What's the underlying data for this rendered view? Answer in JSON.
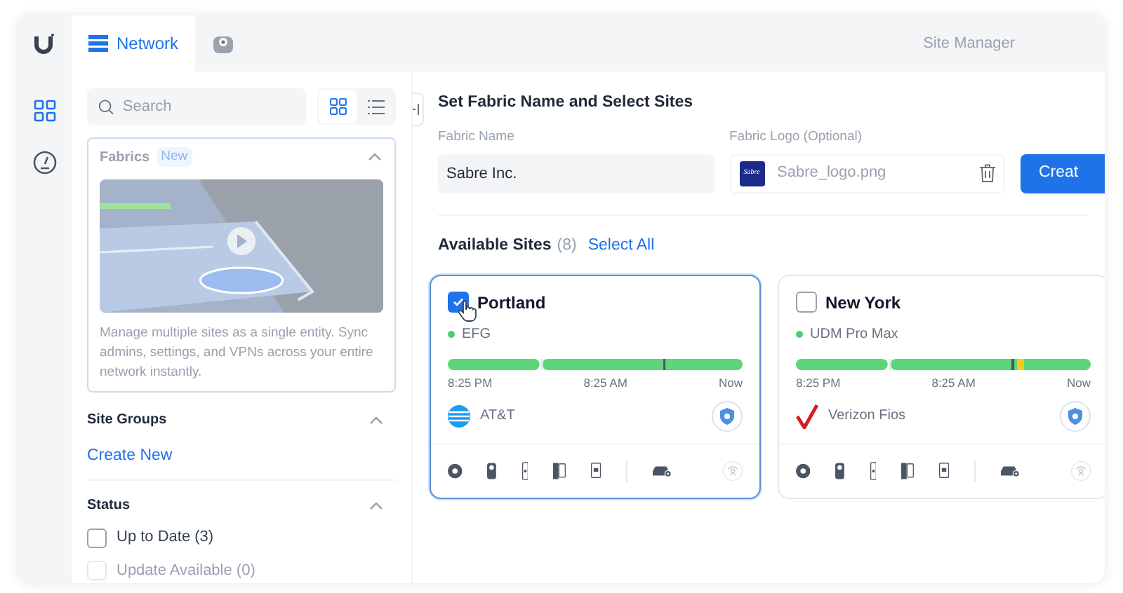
{
  "topbar": {
    "tabs": [
      {
        "label": "Network",
        "selected": true,
        "kind": "network"
      },
      {
        "selected": false,
        "kind": "protect"
      }
    ],
    "title": "Site Manager"
  },
  "sidebar": {
    "search": {
      "placeholder": "Search"
    },
    "view_toggle": [
      {
        "kind": "grid",
        "selected": true
      },
      {
        "kind": "list",
        "selected": false
      }
    ],
    "fabrics": {
      "title": "Fabrics",
      "badge": "New",
      "expanded": true,
      "description": "Manage multiple sites as a single entity. Sync admins, settings, and VPNs across your entire network instantly."
    },
    "site_groups": {
      "title": "Site Groups",
      "expanded": true,
      "link": "Create New"
    },
    "status": {
      "title": "Status",
      "expanded": true,
      "options": [
        {
          "label": "Up to Date (3)",
          "checked": false,
          "disabled": false
        },
        {
          "label": "Update Available (0)",
          "checked": false,
          "disabled": true
        }
      ]
    }
  },
  "form": {
    "heading": "Set Fabric Name and Select Sites",
    "name_label": "Fabric Name",
    "name_value": "Sabre Inc.",
    "logo_label": "Fabric Logo (Optional)",
    "logo_text": "Sabre",
    "logo_file": "Sabre_logo.png",
    "create_button": "Creat"
  },
  "sites_header": {
    "title": "Available Sites",
    "count": "(8)",
    "select_all": "Select All"
  },
  "sites": [
    {
      "name": "Portland",
      "selected": true,
      "device": "EFG",
      "online": true,
      "uptime": {
        "kind": "normal"
      },
      "times": [
        "8:25 PM",
        "8:25 AM",
        "Now"
      ],
      "isp": "AT&T",
      "isp_logo": {
        "kind": "att"
      }
    },
    {
      "name": "New York",
      "selected": false,
      "device": "UDM Pro Max",
      "online": true,
      "uptime": {
        "kind": "warning"
      },
      "times": [
        "8:25 PM",
        "8:25 AM",
        "Now"
      ],
      "isp": "Verizon Fios",
      "isp_logo": {
        "kind": "verizon"
      }
    }
  ]
}
